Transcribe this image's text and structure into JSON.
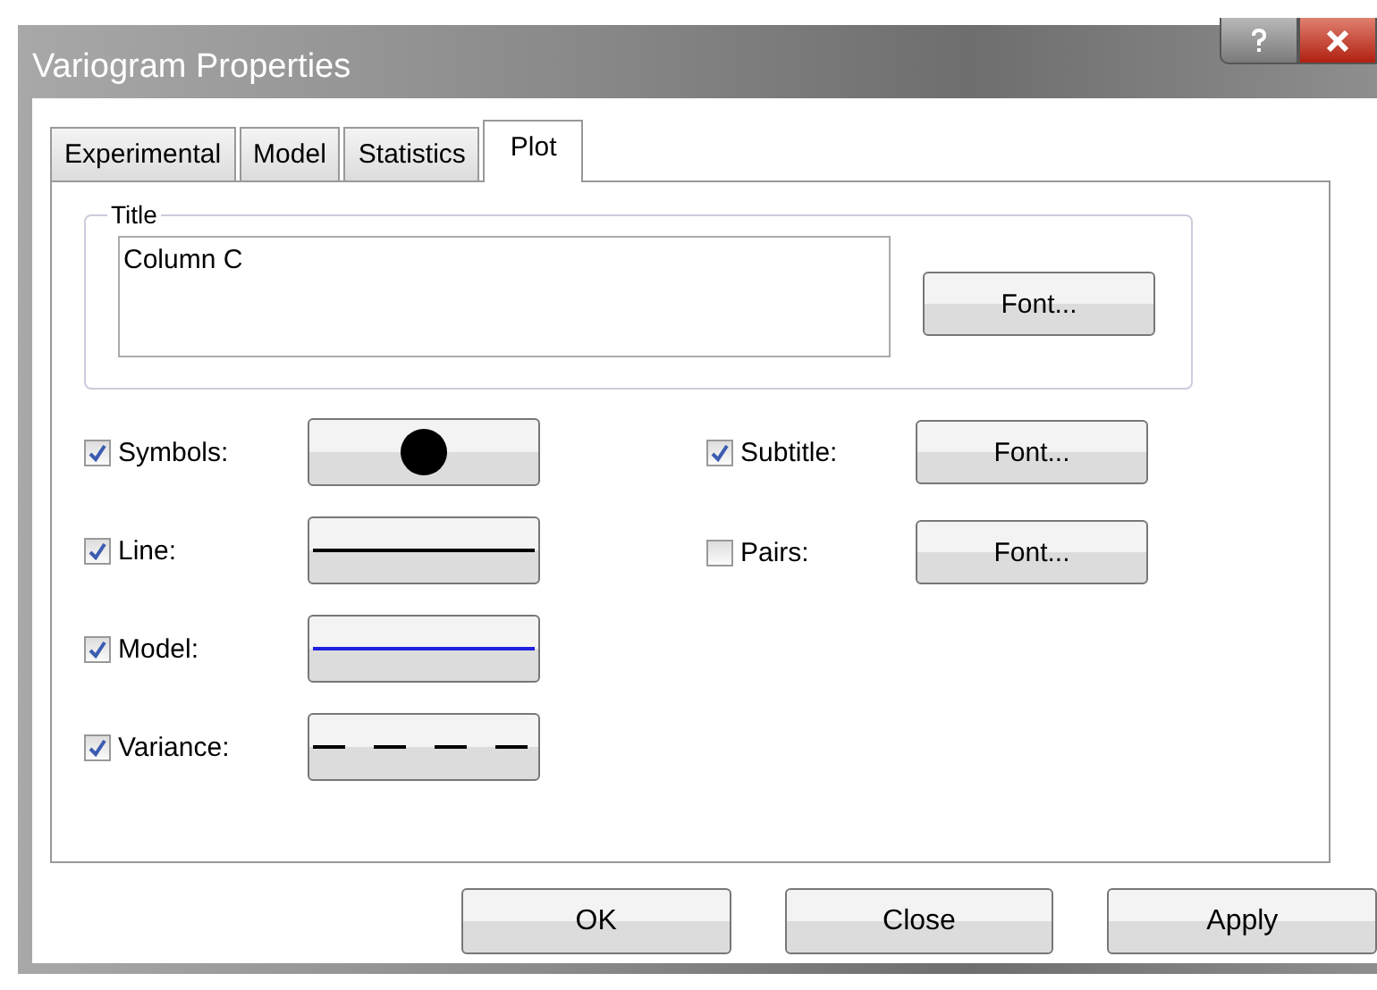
{
  "window": {
    "title": "Variogram Properties"
  },
  "tabs": [
    {
      "label": "Experimental",
      "selected": false
    },
    {
      "label": "Model",
      "selected": false
    },
    {
      "label": "Statistics",
      "selected": false
    },
    {
      "label": "Plot",
      "selected": true
    }
  ],
  "title_group": {
    "label": "Title",
    "value": "Column C",
    "button": "Font..."
  },
  "left_options": [
    {
      "label": "Symbols:",
      "checked": true,
      "kind": "symbol"
    },
    {
      "label": "Line:",
      "checked": true,
      "kind": "solid"
    },
    {
      "label": "Model:",
      "checked": true,
      "kind": "blue-line"
    },
    {
      "label": "Variance:",
      "checked": true,
      "kind": "dashed"
    }
  ],
  "right_options": [
    {
      "label": "Subtitle:",
      "checked": true,
      "button": "Font..."
    },
    {
      "label": "Pairs:",
      "checked": false,
      "button": "Font..."
    }
  ],
  "buttons": [
    "OK",
    "Close",
    "Apply"
  ]
}
